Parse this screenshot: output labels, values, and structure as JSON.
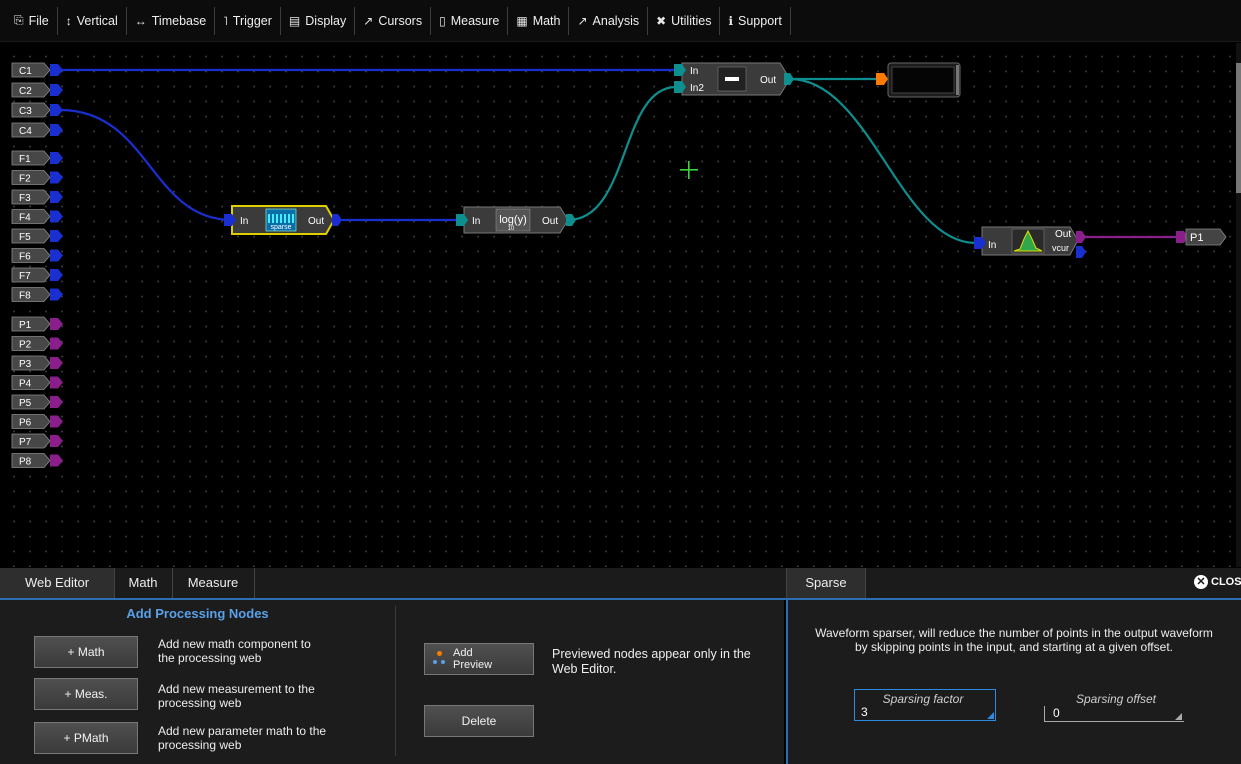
{
  "menu": [
    {
      "icon": "clipboard-icon",
      "glyph": "⎘",
      "label": "File"
    },
    {
      "icon": "vertical-arrow-icon",
      "glyph": "↕",
      "label": "Vertical"
    },
    {
      "icon": "horizontal-arrow-icon",
      "glyph": "↔",
      "label": "Timebase"
    },
    {
      "icon": "trigger-icon",
      "glyph": "˥",
      "label": "Trigger"
    },
    {
      "icon": "display-icon",
      "glyph": "▤",
      "label": "Display"
    },
    {
      "icon": "cursor-icon",
      "glyph": "↗",
      "label": "Cursors"
    },
    {
      "icon": "measure-icon",
      "glyph": "▯",
      "label": "Measure"
    },
    {
      "icon": "calculator-icon",
      "glyph": "▦",
      "label": "Math"
    },
    {
      "icon": "chart-icon",
      "glyph": "↗",
      "label": "Analysis"
    },
    {
      "icon": "tools-icon",
      "glyph": "✖",
      "label": "Utilities"
    },
    {
      "icon": "info-icon",
      "glyph": "ℹ",
      "label": "Support"
    }
  ],
  "web": {
    "channels": [
      "C1",
      "C2",
      "C3",
      "C4"
    ],
    "functions": [
      "F1",
      "F2",
      "F3",
      "F4",
      "F5",
      "F6",
      "F7",
      "F8"
    ],
    "parameters": [
      "P1",
      "P2",
      "P3",
      "P4",
      "P5",
      "P6",
      "P7",
      "P8"
    ],
    "sparse_node": {
      "in": "In",
      "out": "Out",
      "caption": "sparse"
    },
    "log_node": {
      "in": "In",
      "out": "Out",
      "formula": "log(y)",
      "sub": "10"
    },
    "diff_node": {
      "in1": "In",
      "in2": "In2",
      "out": "Out",
      "symbol": "—"
    },
    "meas_node": {
      "in": "In",
      "out": "Out",
      "caption": "vcur"
    },
    "output_param": "P1",
    "colors": {
      "channel_wire": "#1a2fd0",
      "function_wire": "#0e8f8f",
      "param_wire": "#8a1e8a",
      "selection": "#e0d000",
      "preview_port": "#ff7a00"
    }
  },
  "dialog": {
    "tabs_left": [
      "Web Editor",
      "Math",
      "Measure"
    ],
    "tab_right": "Sparse",
    "close_label": "CLOS",
    "add_heading": "Add Processing Nodes",
    "buttons": [
      {
        "label": "+ Math",
        "desc": "Add new math component to the processing web"
      },
      {
        "label": "+ Meas.",
        "desc": "Add new measurement to the processing web"
      },
      {
        "label": "+ PMath",
        "desc": "Add new parameter math to the processing web"
      }
    ],
    "add_preview_label": "Add Preview",
    "preview_note": "Previewed nodes appear only in the Web Editor.",
    "delete_label": "Delete",
    "sparse_desc": "Waveform sparser, will reduce the number of points in the output waveform by skipping points in the input, and starting at a given offset.",
    "sparsing_factor_label": "Sparsing factor",
    "sparsing_factor_value": "3",
    "sparsing_offset_label": "Sparsing offset",
    "sparsing_offset_value": "0"
  }
}
